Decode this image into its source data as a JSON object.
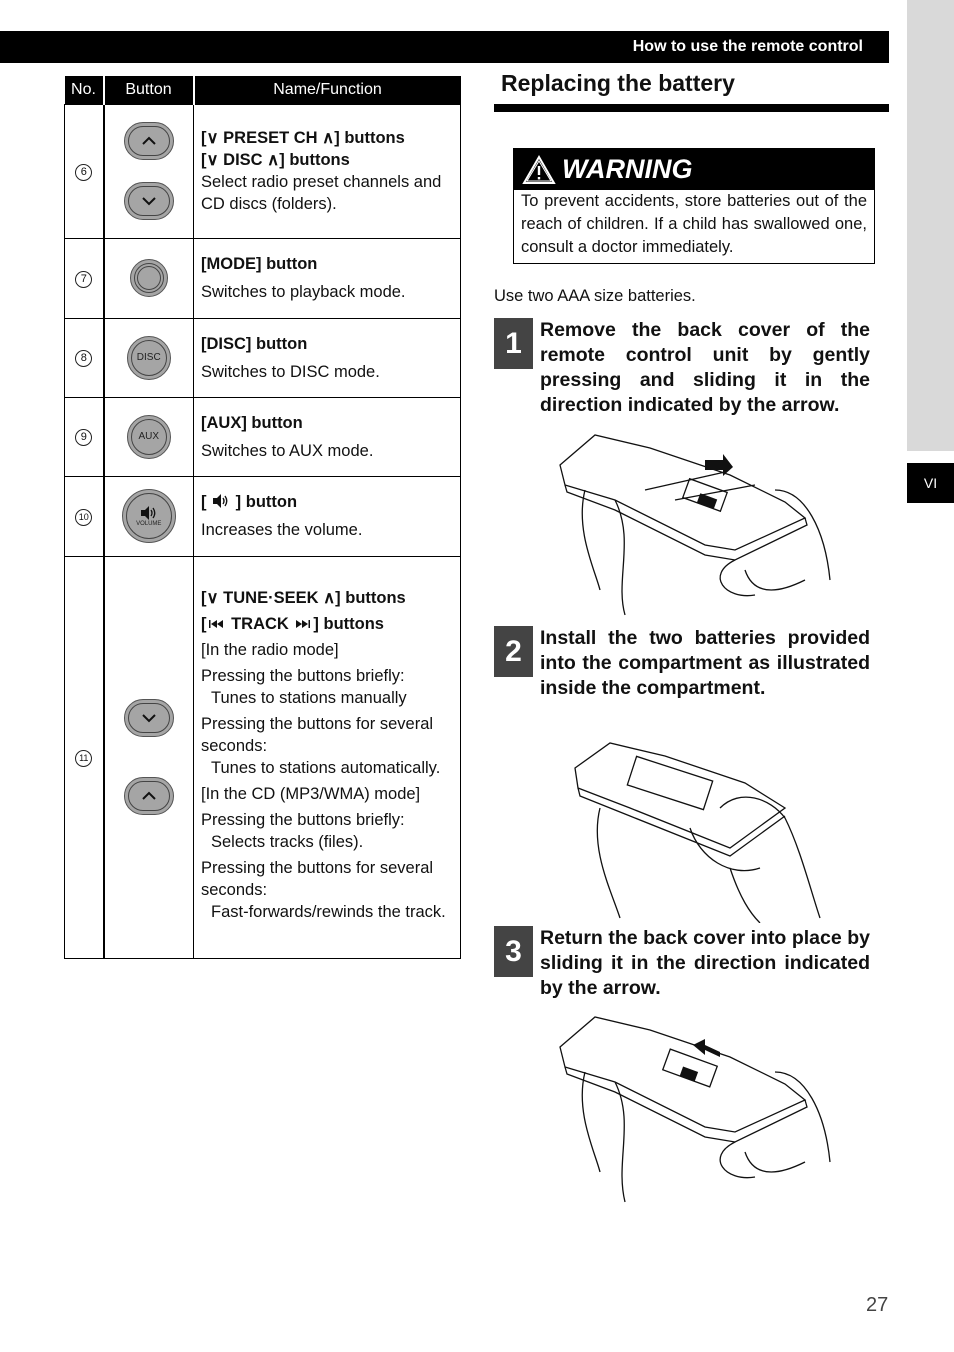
{
  "header": {
    "title": "How to use the remote control"
  },
  "side_tab": {
    "label": "VI"
  },
  "table": {
    "headers": [
      "No.",
      "Button",
      "Name/Function"
    ],
    "rows": [
      {
        "no": "6",
        "buttons": [
          "up-pill",
          "down-pill"
        ],
        "title_lines": [
          "[∨  PRESET CH  ∧] buttons",
          "[∨  DISC  ∧] buttons"
        ],
        "desc": [
          "Select radio preset channels and CD discs (folders)."
        ]
      },
      {
        "no": "7",
        "buttons": [
          "mode-round"
        ],
        "title_lines": [
          "[MODE] button"
        ],
        "desc": [
          "Switches to playback mode."
        ]
      },
      {
        "no": "8",
        "buttons": [
          "disc-round"
        ],
        "button_label": "DISC",
        "title_lines": [
          "[DISC] button"
        ],
        "desc": [
          "Switches to DISC mode."
        ]
      },
      {
        "no": "9",
        "buttons": [
          "aux-round"
        ],
        "button_label": "AUX",
        "title_lines": [
          "[AUX] button"
        ],
        "desc": [
          "Switches to AUX mode."
        ]
      },
      {
        "no": "10",
        "buttons": [
          "volume-round"
        ],
        "button_label": "VOLUME",
        "title_lines": [
          "[ 🔊 ] button"
        ],
        "desc": [
          "Increases the volume."
        ]
      },
      {
        "no": "11",
        "buttons": [
          "down-pill",
          "up-pill"
        ],
        "title_lines": [
          "[∨  TUNE·SEEK  ∧] buttons",
          "[⏮  TRACK  ⏭] buttons"
        ],
        "desc": [
          "[In the radio mode]",
          "Pressing the buttons briefly:",
          "Tunes to stations manually",
          "Pressing the buttons for several seconds:",
          "Tunes to stations automatically.",
          "[In the CD (MP3/WMA) mode]",
          "Pressing the buttons briefly:",
          "Selects tracks (files).",
          "Pressing the buttons for several seconds:",
          "Fast-forwards/rewinds the track."
        ]
      }
    ]
  },
  "section": {
    "title": "Replacing the battery",
    "warning": {
      "heading": "WARNING",
      "text": "To prevent accidents, store batteries out of the reach of children. If a child has swallowed one, consult a doctor immediately."
    },
    "note": "Use two AAA size batteries.",
    "steps": [
      {
        "num": "1",
        "text": "Remove the back cover of the remote control unit by gently pressing and sliding it in the direction indicated by the arrow."
      },
      {
        "num": "2",
        "text": "Install the two batteries provided into the compartment as illustrated inside the compartment."
      },
      {
        "num": "3",
        "text": "Return the back cover into place by sliding it in the direction indicated by the arrow."
      }
    ]
  },
  "page_number": "27"
}
